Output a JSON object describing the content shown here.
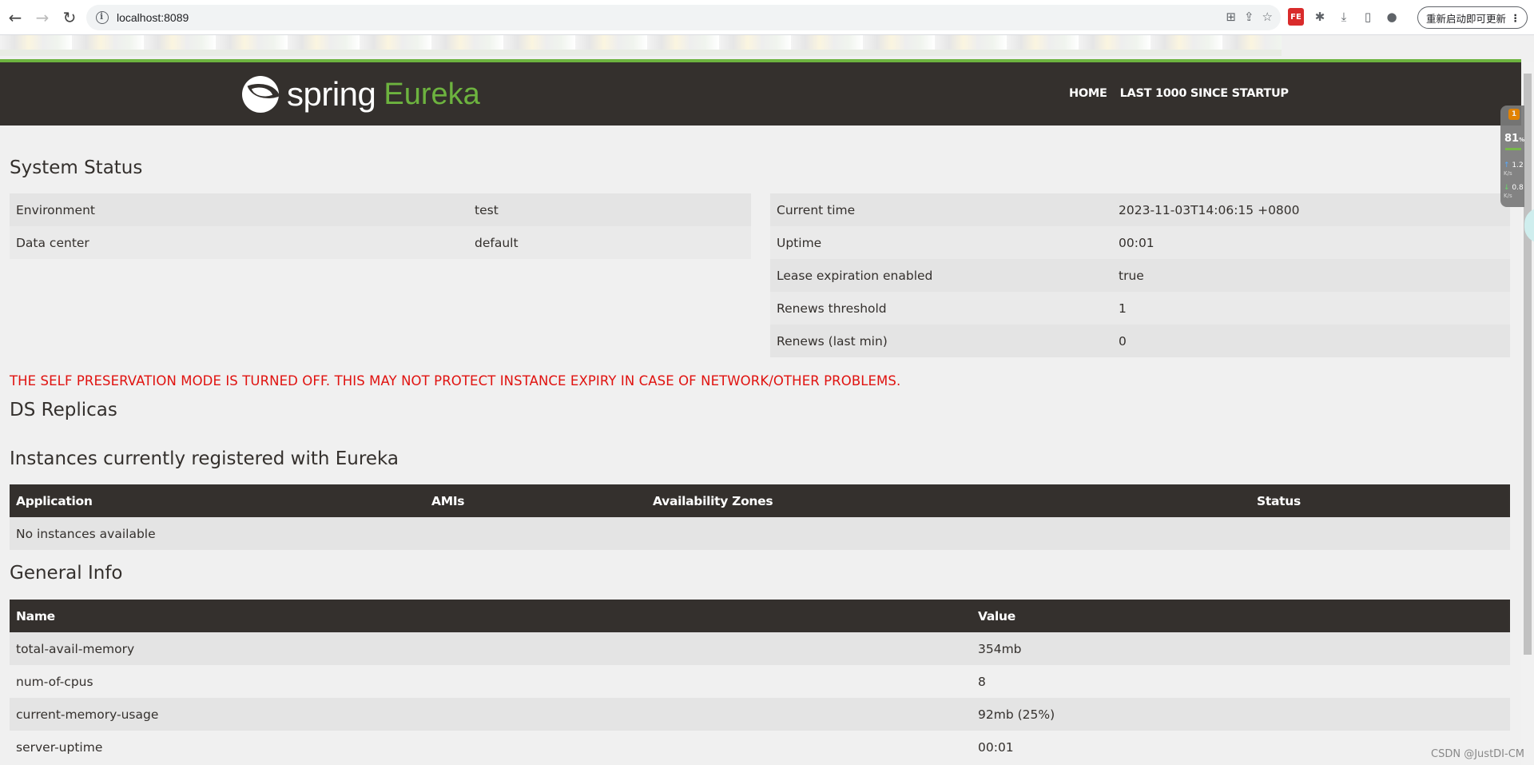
{
  "browser": {
    "url": "localhost:8089",
    "update_button": "重新启动即可更新"
  },
  "navbar": {
    "logo_spring": "spring",
    "logo_eureka": "Eureka",
    "links": [
      "HOME",
      "LAST 1000 SINCE STARTUP"
    ]
  },
  "system_status": {
    "title": "System Status",
    "left": [
      {
        "label": "Environment",
        "value": "test"
      },
      {
        "label": "Data center",
        "value": "default"
      }
    ],
    "right": [
      {
        "label": "Current time",
        "value": "2023-11-03T14:06:15 +0800"
      },
      {
        "label": "Uptime",
        "value": "00:01"
      },
      {
        "label": "Lease expiration enabled",
        "value": "true"
      },
      {
        "label": "Renews threshold",
        "value": "1"
      },
      {
        "label": "Renews (last min)",
        "value": "0"
      }
    ]
  },
  "warning": "THE SELF PRESERVATION MODE IS TURNED OFF. THIS MAY NOT PROTECT INSTANCE EXPIRY IN CASE OF NETWORK/OTHER PROBLEMS.",
  "ds_replicas": {
    "title": "DS Replicas"
  },
  "instances": {
    "title": "Instances currently registered with Eureka",
    "headers": [
      "Application",
      "AMIs",
      "Availability Zones",
      "Status"
    ],
    "empty_text": "No instances available"
  },
  "general_info": {
    "title": "General Info",
    "headers": [
      "Name",
      "Value"
    ],
    "rows": [
      {
        "name": "total-avail-memory",
        "value": "354mb"
      },
      {
        "name": "num-of-cpus",
        "value": "8"
      },
      {
        "name": "current-memory-usage",
        "value": "92mb (25%)"
      },
      {
        "name": "server-uptime",
        "value": "00:01"
      }
    ]
  },
  "net_widget": {
    "badge": "1",
    "percent": "81",
    "percent_unit": "%",
    "up": "1.2",
    "up_unit": "K/s",
    "down": "0.8",
    "down_unit": "K/s"
  },
  "watermark": "CSDN @JustDI-CM",
  "colors": {
    "navbar_bg": "#34302d",
    "accent_green": "#6db33f",
    "warning_red": "#e0120f"
  }
}
